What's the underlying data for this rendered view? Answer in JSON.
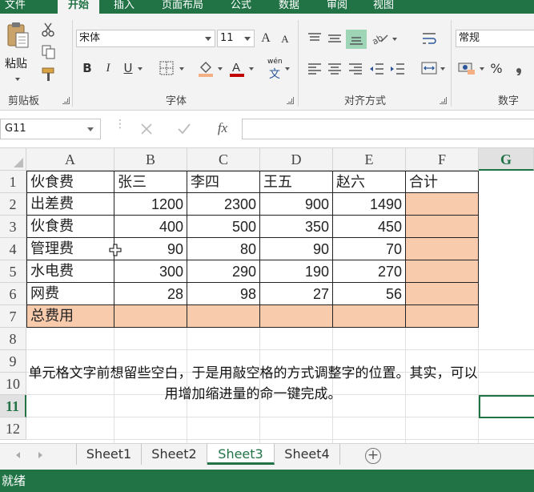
{
  "ribbon_tabs": [
    "文件",
    "开始",
    "插入",
    "页面布局",
    "公式",
    "数据",
    "审阅",
    "视图"
  ],
  "active_tab": "开始",
  "clipboard": {
    "paste_label": "粘贴",
    "group_label": "剪贴板"
  },
  "font": {
    "name": "宋体",
    "size": "11",
    "group_label": "字体",
    "bold": "B",
    "italic": "I",
    "underline": "U",
    "grow": "A",
    "shrink": "A",
    "phonetic": "wén",
    "phonetic_char": "文"
  },
  "alignment": {
    "group_label": "对齐方式"
  },
  "number": {
    "format": "常规",
    "group_label": "数字",
    "percent": "%"
  },
  "formula_bar": {
    "name_box": "G11",
    "fx_label": "fx",
    "formula": ""
  },
  "columns": [
    "A",
    "B",
    "C",
    "D",
    "E",
    "F",
    "G"
  ],
  "rows": [
    "1",
    "2",
    "3",
    "4",
    "5",
    "6",
    "7",
    "8",
    "9",
    "10",
    "11",
    "12"
  ],
  "table": {
    "header": [
      "伙食费",
      "张三",
      "李四",
      "王五",
      "赵六",
      "合计"
    ],
    "rows": [
      [
        "出差费",
        "1200",
        "2300",
        "900",
        "1490",
        ""
      ],
      [
        "伙食费",
        "400",
        "500",
        "350",
        "450",
        ""
      ],
      [
        "管理费",
        "90",
        "80",
        "90",
        "70",
        ""
      ],
      [
        "水电费",
        "300",
        "290",
        "190",
        "270",
        ""
      ],
      [
        "网费",
        "28",
        "98",
        "27",
        "56",
        ""
      ],
      [
        "总费用",
        "",
        "",
        "",
        "",
        ""
      ]
    ]
  },
  "note": "单元格文字前想留些空白，于是用敲空格的方式调整字的位置。其实，可以用增加缩进量的命一键完成。",
  "sheets": [
    "Sheet1",
    "Sheet2",
    "Sheet3",
    "Sheet4"
  ],
  "active_sheet": "Sheet3",
  "add_sheet": "+",
  "status": "就绪",
  "colors": {
    "accent": "#217346",
    "total_fill": "#f8cbad"
  }
}
